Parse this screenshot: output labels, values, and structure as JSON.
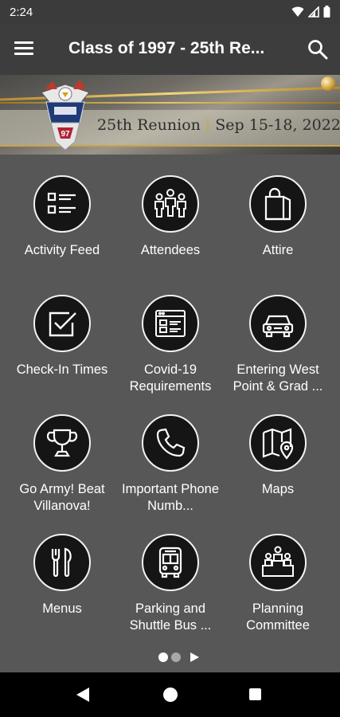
{
  "status_bar": {
    "time": "2:24",
    "icons": [
      "wifi-icon",
      "signal-icon",
      "battery-icon"
    ]
  },
  "app_bar": {
    "title": "Class of 1997 - 25th Re...",
    "menu_icon": "hamburger-menu-icon",
    "search_icon": "search-icon"
  },
  "banner": {
    "reunion": "25th Reunion",
    "separator": "|",
    "dates": "Sep 15-18, 2022"
  },
  "tiles": [
    {
      "label": "Activity Feed",
      "icon": "list-icon"
    },
    {
      "label": "Attendees",
      "icon": "people-icon"
    },
    {
      "label": "Attire",
      "icon": "shopping-bag-icon"
    },
    {
      "label": "Check-In Times",
      "icon": "checkbox-icon"
    },
    {
      "label": "Covid-19 Requirements",
      "icon": "browser-form-icon"
    },
    {
      "label": "Entering West Point & Grad ...",
      "icon": "car-icon"
    },
    {
      "label": "Go Army! Beat Villanova!",
      "icon": "trophy-icon"
    },
    {
      "label": "Important Phone Numb...",
      "icon": "phone-icon"
    },
    {
      "label": "Maps",
      "icon": "map-icon"
    },
    {
      "label": "Menus",
      "icon": "fork-knife-icon"
    },
    {
      "label": "Parking and Shuttle Bus ...",
      "icon": "bus-icon"
    },
    {
      "label": "Planning Committee",
      "icon": "podium-people-icon"
    }
  ],
  "pagination": {
    "current_page": 1,
    "total_pages": 2
  },
  "colors": {
    "background": "#575757",
    "app_bar": "#3d3d3d",
    "icon_fill": "#151515",
    "accent_gold": "#c9a44a"
  }
}
